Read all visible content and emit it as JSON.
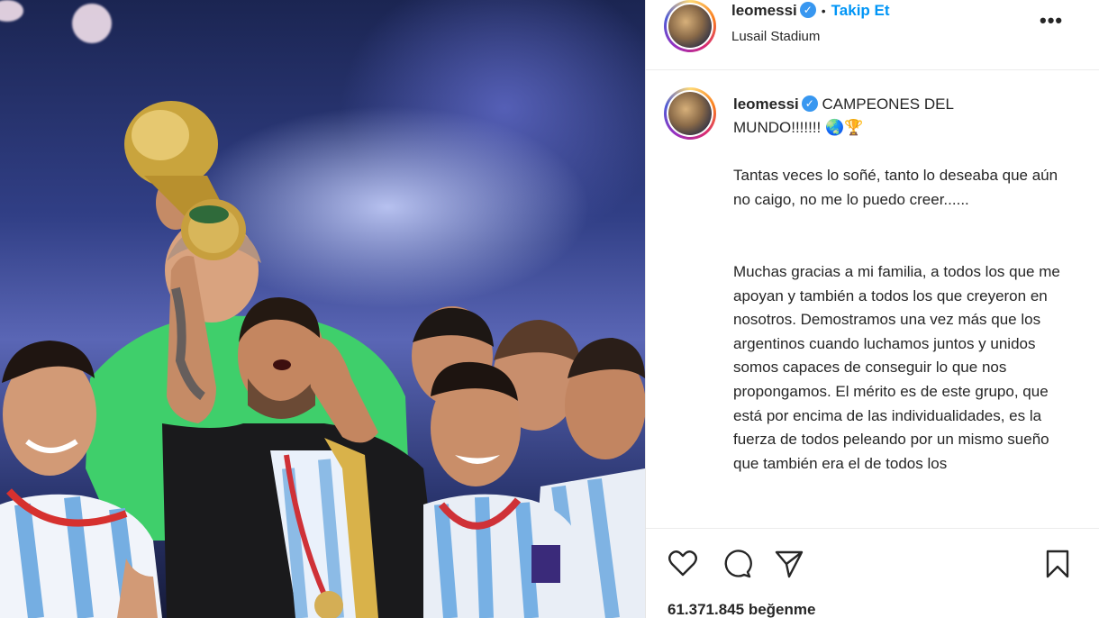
{
  "post": {
    "username": "leomessi",
    "follow_label": "Takip Et",
    "location": "Lusail Stadium",
    "caption_title": "CAMPEONES DEL MUNDO!!!!!!!",
    "caption_emoji": "🌏🏆",
    "paragraph_1": "Tantas veces lo soñé, tanto lo deseaba que aún no caigo, no me lo puedo creer......",
    "paragraph_2": "Muchas gracias a mi familia, a todos los que me apoyan y también a todos los que creyeron en nosotros. Demostramos una vez más que los argentinos cuando luchamos juntos y unidos somos capaces de conseguir lo que nos propongamos. El mérito es de este grupo, que está por encima de las individualidades, es la fuerza de todos peleando por un mismo sueño que también era el de todos los",
    "likes_count": "61.371.845",
    "likes_label": "beğenme"
  },
  "icons": {
    "verified": "verified-badge-icon",
    "more": "more-options-icon",
    "like": "heart-icon",
    "comment": "comment-icon",
    "share": "share-icon",
    "save": "bookmark-icon"
  },
  "colors": {
    "accent": "#0095f6",
    "verified": "#3897f0",
    "text": "#262626"
  }
}
